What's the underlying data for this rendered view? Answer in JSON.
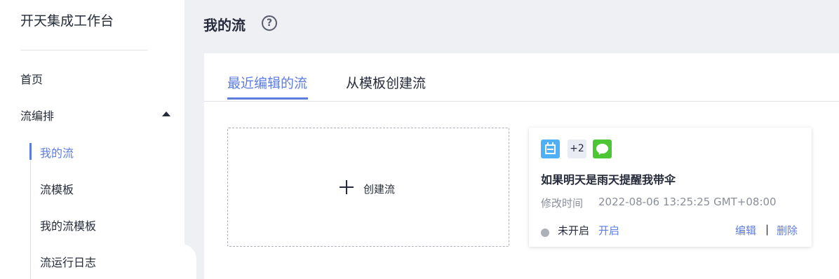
{
  "sidebar": {
    "title": "开天集成工作台",
    "home": "首页",
    "flow_group": "流编排",
    "sub_items": [
      "我的流",
      "流模板",
      "我的流模板",
      "流运行日志"
    ]
  },
  "header": {
    "title": "我的流",
    "help_icon": "?"
  },
  "tabs": [
    {
      "label": "最近编辑的流",
      "active": true
    },
    {
      "label": "从模板创建流",
      "active": false
    }
  ],
  "create_card": {
    "label": "创建流"
  },
  "flow_card": {
    "extra_connectors": "+2",
    "name": "如果明天是雨天提醒我带伞",
    "modified_label": "修改时间",
    "modified_time": "2022-08-06 13:25:25 GMT+08:00",
    "status": "未开启",
    "enable": "开启",
    "edit": "编辑",
    "separator": "|",
    "delete": "删除",
    "icons": [
      "calendar-icon",
      "message-icon"
    ]
  },
  "colors": {
    "accent": "#5e7ce0",
    "text": "#252b3a",
    "muted": "#8a8e99",
    "background": "#eef0f4",
    "calendar_icon": "#4fb0f7",
    "message_icon": "#4cc634"
  }
}
